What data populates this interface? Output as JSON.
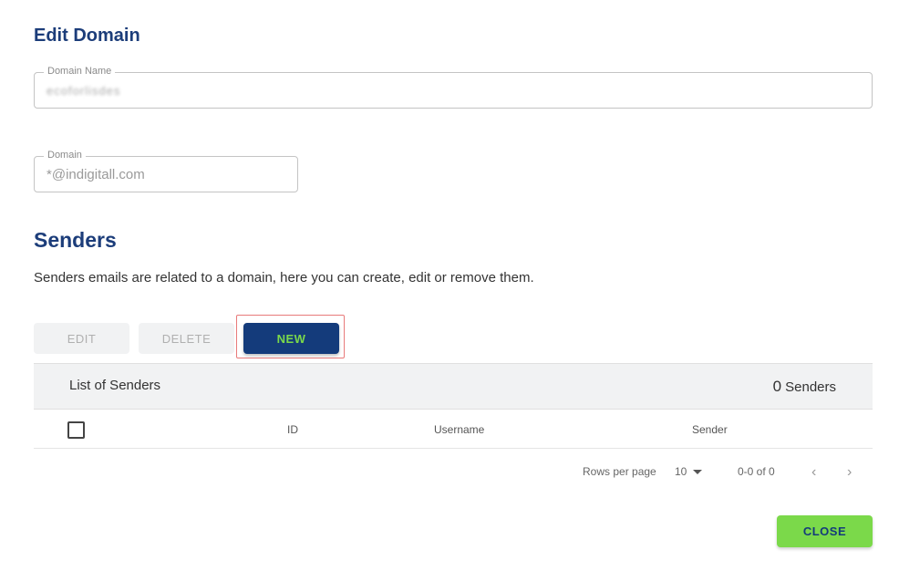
{
  "header": {
    "title": "Edit Domain"
  },
  "domain_name_field": {
    "label": "Domain Name",
    "value": "ecoforlisdes"
  },
  "domain_field": {
    "label": "Domain",
    "value": "*@indigitall.com"
  },
  "senders": {
    "title": "Senders",
    "description": "Senders emails are related to a domain, here you can create, edit or remove them.",
    "edit_label": "EDIT",
    "delete_label": "DELETE",
    "new_label": "NEW",
    "list_label": "List of Senders",
    "count": "0",
    "count_suffix": "Senders",
    "columns": [
      "ID",
      "Username",
      "Sender"
    ]
  },
  "pagination": {
    "rows_per_page_label": "Rows per page",
    "rows_per_page": "10",
    "range": "0-0 of 0",
    "prev_icon": "chevron-left-icon",
    "next_icon": "chevron-right-icon"
  },
  "footer": {
    "close_label": "CLOSE"
  },
  "colors": {
    "brand_navy": "#143b7b",
    "brand_green": "#7bd94a",
    "highlight": "#e87a7a"
  }
}
